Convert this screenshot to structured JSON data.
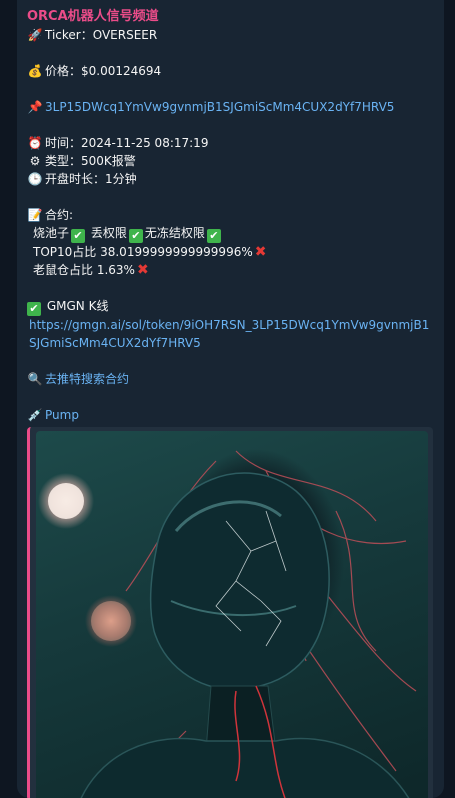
{
  "message": {
    "sender": "ORCA机器人信号频道",
    "ticker_line": "Ticker：OVERSEER",
    "price_line": "价格：$0.00124694",
    "contract_address": "3LP15DWcq1YmVw9gvnmjB1SJGmiScMm4CUX2dYf7HRV5",
    "time_line": "时间：2024-11-25 08:17:19",
    "type_line": "类型：500K报警",
    "open_duration_line": "开盘时长：1分钟",
    "contract_title": "合约:",
    "flags": {
      "pool": "烧池子",
      "renounced": "丢权限",
      "no_freeze": "无冻结权限"
    },
    "top10_line": "TOP10占比 38.0199999999999996%",
    "rat_line": "老鼠仓占比 1.63%",
    "gmgn_label": "GMGN K线",
    "gmgn_url": "https://gmgn.ai/sol/token/9iOH7RSN_3LP15DWcq1YmVw9gvnmjB1SJGmiScMm4CUX2dYf7HRV5",
    "twitter_search": "去推特搜索合约",
    "pump_label": "Pump"
  },
  "icons": {
    "rocket": "rocket-icon",
    "money_bag": "money-bag-icon",
    "pin": "pushpin-icon",
    "alarm": "alarm-clock-icon",
    "gear": "gear-icon",
    "clock": "clock-icon",
    "memo": "memo-icon",
    "check": "check-mark-icon",
    "cross": "cross-mark-icon",
    "magnifier": "magnifier-icon",
    "syringe": "syringe-icon"
  },
  "colors": {
    "sender": "#ea4c89",
    "link": "#6ab3f3",
    "check_bg": "#3fb44c",
    "cross": "#e53935",
    "bubble_bg": "#182533"
  }
}
